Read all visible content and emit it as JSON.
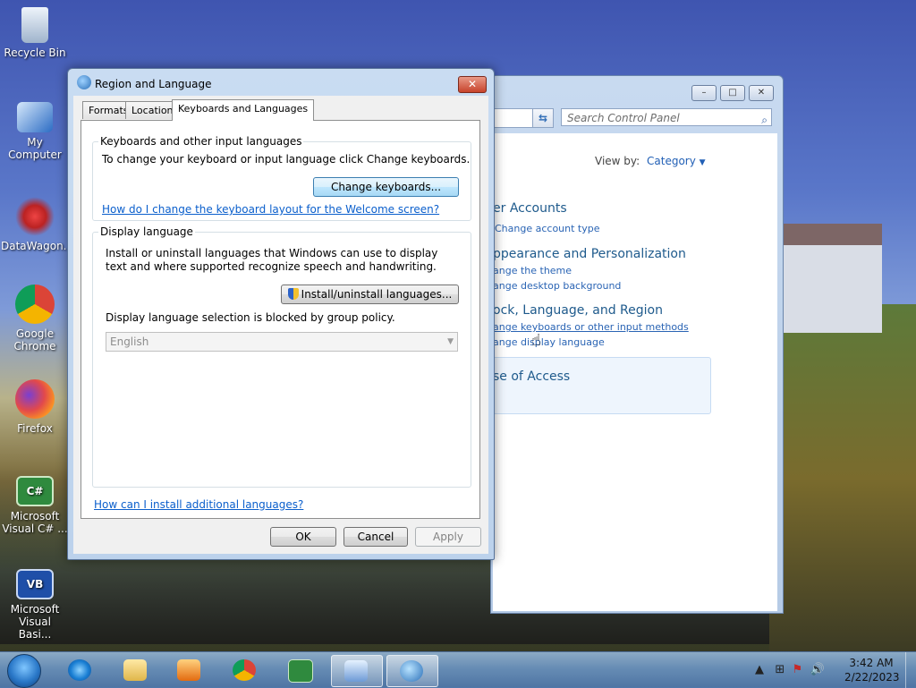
{
  "desktop": {
    "icons": [
      {
        "label": "Recycle Bin"
      },
      {
        "label": "My Computer"
      },
      {
        "label": "DataWagon..."
      },
      {
        "label": "Google Chrome"
      },
      {
        "label": "Firefox"
      },
      {
        "label": "Microsoft Visual C# ..."
      },
      {
        "label": "Microsoft Visual Basi..."
      }
    ]
  },
  "control_panel": {
    "search_placeholder": "Search Control Panel",
    "view_by_label": "View by:",
    "view_by_value": "Category",
    "categories": [
      {
        "title": "er Accounts",
        "links": [
          "Change account type"
        ]
      },
      {
        "title": "ppearance and Personalization",
        "links": [
          "ange the theme",
          "ange desktop background"
        ]
      },
      {
        "title": "ock, Language, and Region",
        "links": [
          "ange keyboards or other input methods",
          "ange display language"
        ]
      },
      {
        "title": "se of Access",
        "links": []
      }
    ],
    "buttons": {
      "minimize": "▭",
      "maximize": "▭",
      "close": "✕"
    }
  },
  "dialog": {
    "title": "Region and Language",
    "close_label": "✕",
    "tabs": [
      {
        "label": "Formats"
      },
      {
        "label": "Location"
      },
      {
        "label": "Keyboards and Languages"
      }
    ],
    "keyboards_group": {
      "title": "Keyboards and other input languages",
      "description": "To change your keyboard or input language click Change keyboards.",
      "button": "Change keyboards...",
      "link": "How do I change the keyboard layout for the Welcome screen?"
    },
    "display_group": {
      "title": "Display language",
      "description": "Install or uninstall languages that Windows can use to display text and where supported recognize speech and handwriting.",
      "install_button": "Install/uninstall languages...",
      "blocked_text": "Display language selection is blocked by group policy.",
      "selected_language": "English"
    },
    "bottom_link": "How can I install additional languages?",
    "buttons": {
      "ok": "OK",
      "cancel": "Cancel",
      "apply": "Apply"
    }
  },
  "taskbar": {
    "time": "3:42 AM",
    "date": "2/22/2023",
    "tray_icons": [
      "▲",
      "⊞",
      "⚑",
      "🔊"
    ]
  },
  "colors": {
    "link": "#0b5fcc",
    "cp_category": "#1e5a8c",
    "dialog_frame": "#c9dcf2"
  }
}
